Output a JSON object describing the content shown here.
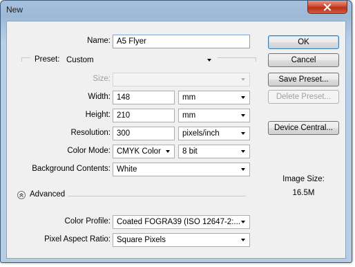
{
  "window": {
    "title": "New"
  },
  "form": {
    "name_label": "Name:",
    "name_value": "A5 Flyer",
    "preset_label": "Preset:",
    "preset_value": "Custom",
    "size_label": "Size:",
    "size_value": "",
    "width_label": "Width:",
    "width_value": "148",
    "width_unit": "mm",
    "height_label": "Height:",
    "height_value": "210",
    "height_unit": "mm",
    "resolution_label": "Resolution:",
    "resolution_value": "300",
    "resolution_unit": "pixels/inch",
    "color_mode_label": "Color Mode:",
    "color_mode_value": "CMYK Color",
    "bit_depth_value": "8 bit",
    "background_label": "Background Contents:",
    "background_value": "White",
    "advanced_label": "Advanced",
    "color_profile_label": "Color Profile:",
    "color_profile_value": "Coated FOGRA39 (ISO 12647-2:...",
    "pixel_aspect_label": "Pixel Aspect Ratio:",
    "pixel_aspect_value": "Square Pixels"
  },
  "buttons": {
    "ok": "OK",
    "cancel": "Cancel",
    "save_preset": "Save Preset...",
    "delete_preset": "Delete Preset...",
    "device_central": "Device Central..."
  },
  "image_size": {
    "label": "Image Size:",
    "value": "16.5M"
  },
  "icons": {
    "close": "close-icon",
    "advanced_toggle": "chevron-up-circle-icon",
    "dropdown": "dropdown-arrow-icon"
  },
  "colors": {
    "titlebar": "#a6c1dd",
    "close_button": "#c8402a",
    "dialog_bg": "#f0f0f0"
  }
}
